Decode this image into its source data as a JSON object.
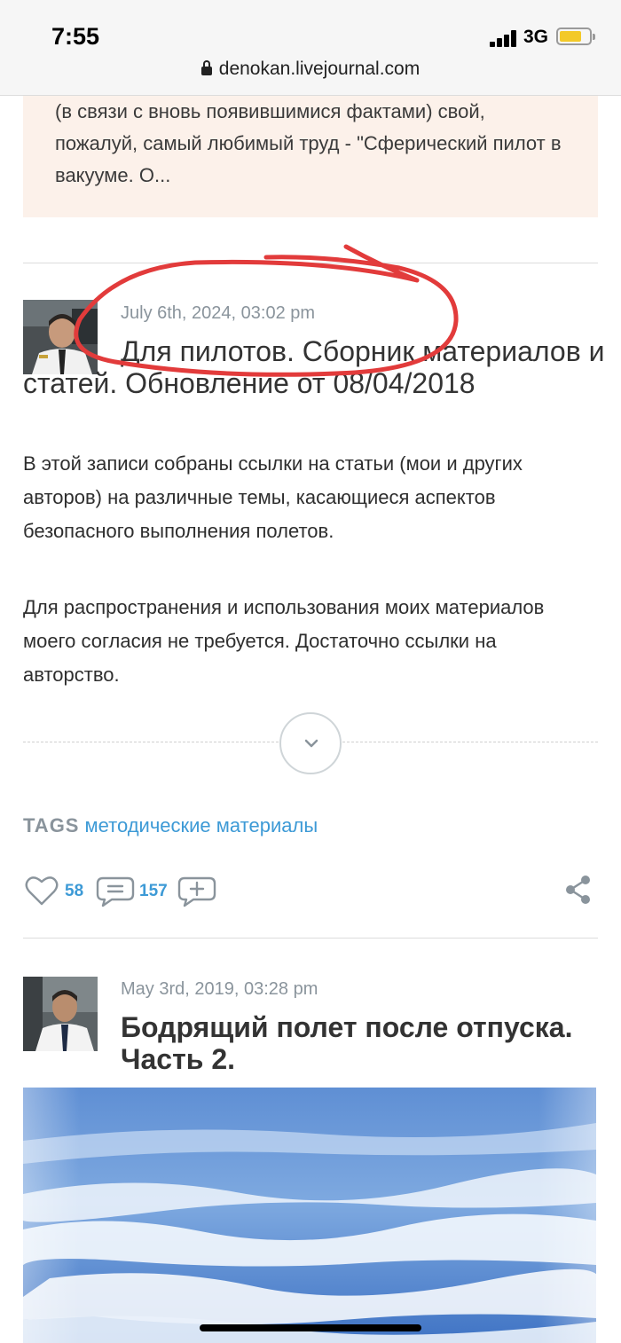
{
  "status": {
    "time": "7:55",
    "network": "3G"
  },
  "browser": {
    "url": "denokan.livejournal.com"
  },
  "excerpt": {
    "text": "(в связи с вновь появившимися фактами) свой, пожалуй, самый любимый труд - \"Сферический пилот в вакууме. О..."
  },
  "entry1": {
    "date": "July 6th, 2024, 03:02 pm",
    "title": "Для пилотов. Сборник материалов и статей. Обновление от 08/04/2018",
    "paragraph1": "В этой записи собраны ссылки на статьи (мои и других авторов) на различные темы, касающиеся аспектов безопасного выполнения полетов.",
    "paragraph2": "Для распространения и использования моих материалов моего согласия не требуется. Достаточно ссылки на авторство.",
    "tags_label": "TAGS",
    "tag": "методические материалы",
    "likes": "58",
    "comments": "157"
  },
  "entry2": {
    "date": "May 3rd, 2019, 03:28 pm",
    "title": "Бодрящий полет после отпуска. Часть 2."
  },
  "icons": [
    "lock-icon",
    "chevron-down-icon",
    "heart-icon",
    "comment-icon",
    "add-comment-icon",
    "share-icon"
  ],
  "colors": {
    "accent": "#3d9ad6",
    "annotation": "#e23b3b",
    "excerpt_bg": "#fcf1ea"
  }
}
